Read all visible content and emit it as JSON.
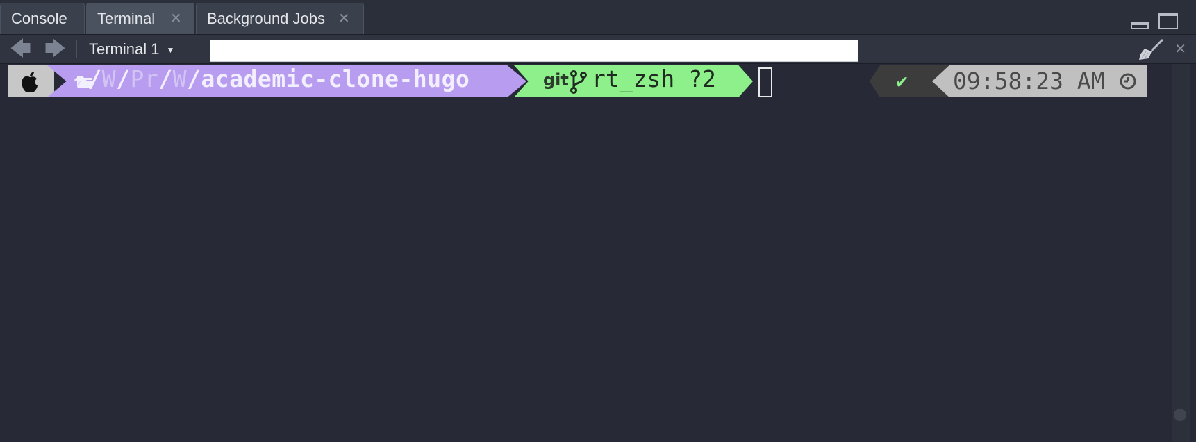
{
  "tabs": [
    {
      "label": "Console",
      "closable": false,
      "active": false
    },
    {
      "label": "Terminal",
      "closable": true,
      "active": true
    },
    {
      "label": "Background Jobs",
      "closable": true,
      "active": false
    }
  ],
  "toolbar": {
    "terminal_select": "Terminal 1",
    "search_value": ""
  },
  "prompt": {
    "apple_icon": "apple-icon",
    "folder_icon": "folder-open-icon",
    "path_home": "~/",
    "path_dim_1": "W",
    "path_slash_1": "/",
    "path_dim_2": "Pr",
    "path_slash_2": "/",
    "path_dim_3": "W",
    "path_slash_3": "/",
    "path_current": "academic-clone-hugo",
    "git_label": "git",
    "branch_icon": "git-branch-icon",
    "branch": "rt_zsh ?2",
    "status_check": "✔",
    "time": "09:58:23 AM",
    "clock_icon": "clock-icon"
  },
  "colors": {
    "path_segment": "#b89cf0",
    "git_segment": "#8df08a",
    "time_segment": "#c0c0c0",
    "apple_segment": "#c7c7c7",
    "status_segment": "#3c3c3c",
    "terminal_bg": "#272a36"
  }
}
